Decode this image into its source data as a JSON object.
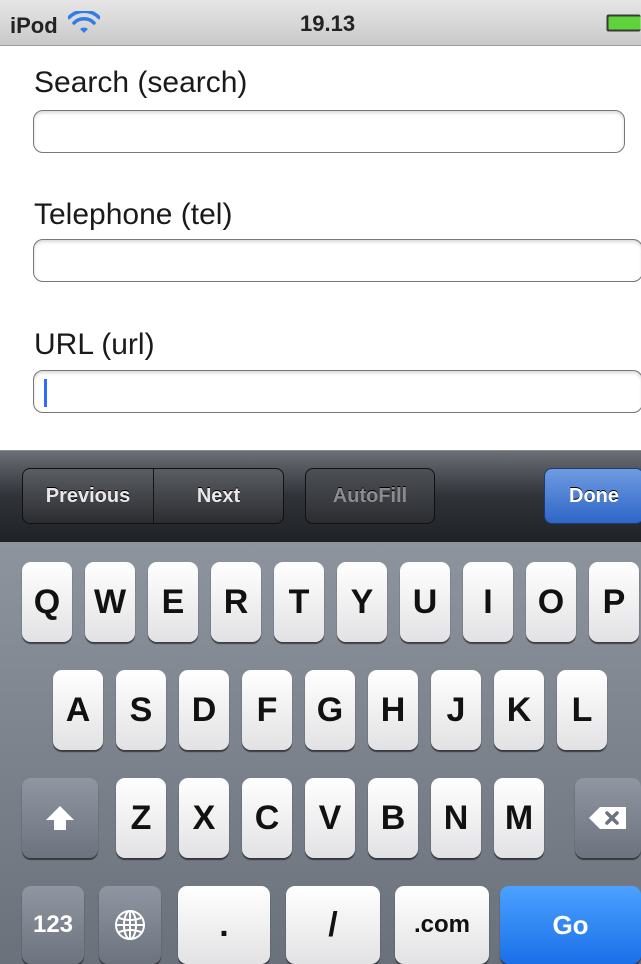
{
  "status_bar": {
    "device": "iPod",
    "time": "19.13",
    "wifi_icon": "wifi-icon",
    "battery_icon": "battery-icon"
  },
  "form": {
    "fields": [
      {
        "label": "Search (search)",
        "value": ""
      },
      {
        "label": "Telephone (tel)",
        "value": ""
      },
      {
        "label": "URL (url)",
        "value": ""
      }
    ]
  },
  "toolbar": {
    "previous": "Previous",
    "next": "Next",
    "autofill": "AutoFill",
    "done": "Done"
  },
  "keyboard": {
    "row1": [
      "Q",
      "W",
      "E",
      "R",
      "T",
      "Y",
      "U",
      "I",
      "O",
      "P"
    ],
    "row2": [
      "A",
      "S",
      "D",
      "F",
      "G",
      "H",
      "J",
      "K",
      "L"
    ],
    "row3": [
      "Z",
      "X",
      "C",
      "V",
      "B",
      "N",
      "M"
    ],
    "numbers_key": "123",
    "period_key": ".",
    "slash_key": "/",
    "dotcom_key": ".com",
    "go_key": "Go",
    "shift_icon": "shift-icon",
    "backspace_icon": "backspace-icon",
    "globe_icon": "globe-icon"
  },
  "colors": {
    "toolbar_done": "#2e66c8",
    "go_key": "#1a6fe8",
    "caret": "#2f6bff"
  }
}
